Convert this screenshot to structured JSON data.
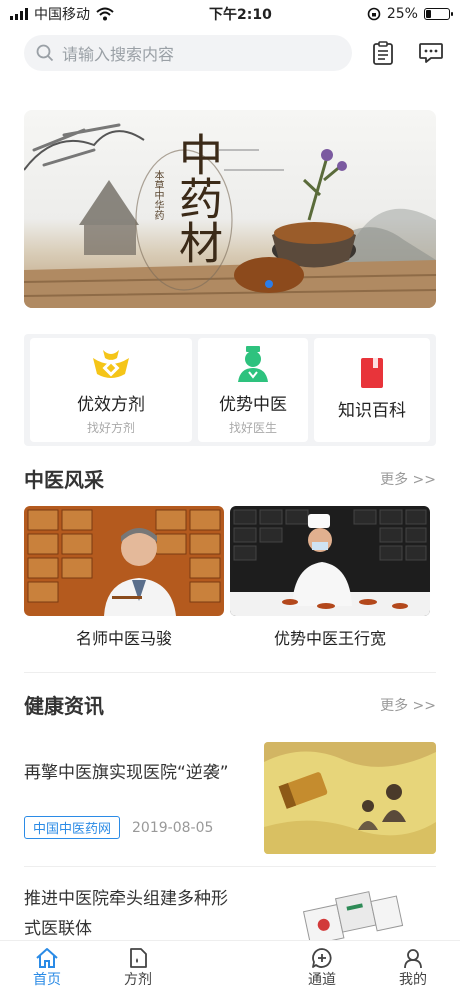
{
  "status_bar": {
    "carrier": "中国移动",
    "time": "下午2:10",
    "battery": "25%",
    "battery_level": 0.25
  },
  "search": {
    "placeholder": "请输入搜索内容"
  },
  "header_icons": [
    "clipboard-icon",
    "message-icon"
  ],
  "banner": {
    "title": "中药材",
    "subtitle_seal": "本草中华药"
  },
  "quick_entries": [
    {
      "title": "优效方剂",
      "subtitle": "找好方剂",
      "icon": "gold-ingot-icon"
    },
    {
      "title": "优势中医",
      "subtitle": "找好医生",
      "icon": "doctor-icon"
    },
    {
      "title": "知识百科",
      "subtitle": "",
      "icon": "book-icon"
    }
  ],
  "section_tcm": {
    "title": "中医风采",
    "more": "更多 >>"
  },
  "tcm_cards": [
    {
      "caption": "名师中医马骏"
    },
    {
      "caption": "优势中医王行宽"
    }
  ],
  "section_news": {
    "title": "健康资讯",
    "more": "更多 >>"
  },
  "news": [
    {
      "title": "再擎中医旗实现医院“逆袭”",
      "source": "中国中医药网",
      "date": "2019-08-05"
    },
    {
      "title": "推进中医院牵头组建多种形式医联体"
    }
  ],
  "tabbar": [
    {
      "label": "首页",
      "icon": "home-icon",
      "active": true
    },
    {
      "label": "方剂",
      "icon": "prescription-icon",
      "active": false
    },
    {
      "label": "通道",
      "icon": "channel-icon",
      "active": false
    },
    {
      "label": "我的",
      "icon": "profile-icon",
      "active": false
    }
  ],
  "colors": {
    "accent": "#2b8be6",
    "gold": "#f5c518",
    "doctor_green": "#2ec27e",
    "book_red": "#e8343a"
  }
}
